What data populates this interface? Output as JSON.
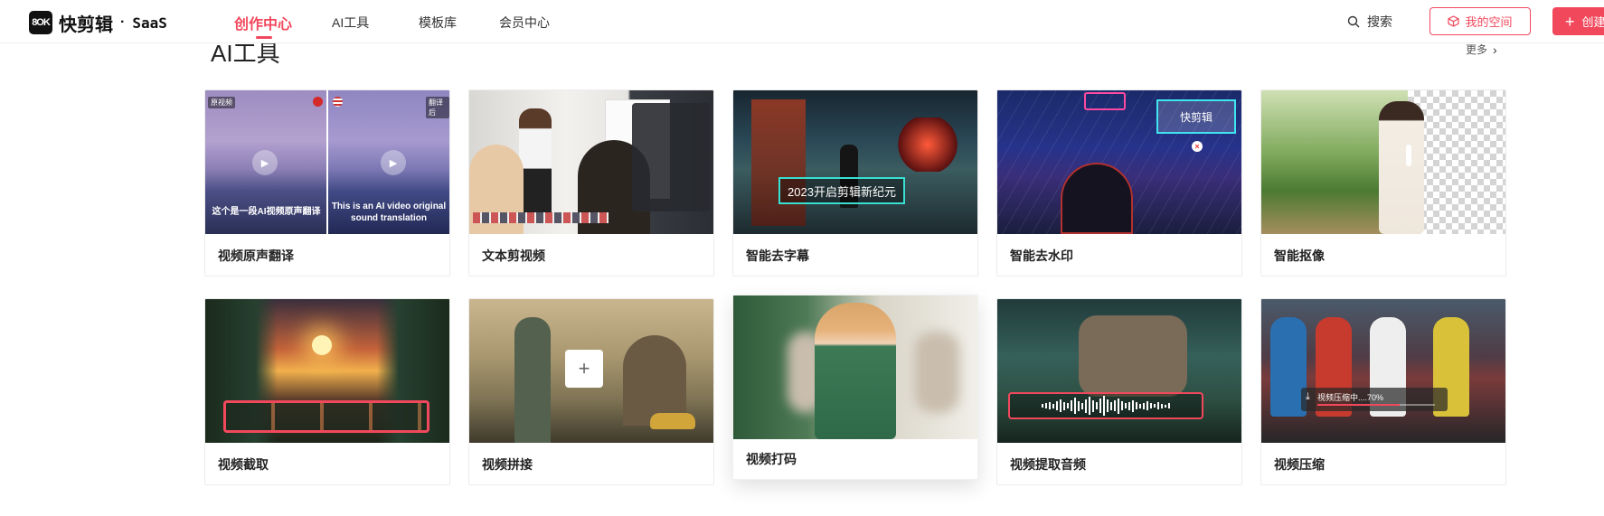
{
  "header": {
    "logo_mark": "8OK",
    "brand_name": "快剪辑",
    "brand_dot": "·",
    "brand_suffix": "SaaS",
    "nav": [
      {
        "label": "创作中心",
        "active": true
      },
      {
        "label": "AI工具",
        "active": false
      },
      {
        "label": "模板库",
        "active": false
      },
      {
        "label": "会员中心",
        "active": false
      }
    ],
    "search_label": "搜索",
    "my_space_label": "我的空间",
    "create_label": "创建"
  },
  "section": {
    "title": "AI工具",
    "more_label": "更多"
  },
  "tools": [
    {
      "label": "视频原声翻译",
      "icon": "translate-thumb"
    },
    {
      "label": "文本剪视频",
      "icon": "text-cut-thumb"
    },
    {
      "label": "智能去字幕",
      "icon": "remove-subtitle-thumb"
    },
    {
      "label": "智能去水印",
      "icon": "remove-watermark-thumb"
    },
    {
      "label": "智能抠像",
      "icon": "matting-thumb"
    },
    {
      "label": "视频截取",
      "icon": "clip-thumb"
    },
    {
      "label": "视频拼接",
      "icon": "stitch-thumb"
    },
    {
      "label": "视频打码",
      "icon": "blur-thumb"
    },
    {
      "label": "视频提取音频",
      "icon": "extract-audio-thumb"
    },
    {
      "label": "视频压缩",
      "icon": "compress-thumb"
    }
  ],
  "thumbnail_text": {
    "translate_tag_left": "原视频",
    "translate_tag_right": "翻译后",
    "translate_caption_zh": "这个是一段AI视频原声翻译",
    "translate_caption_en": "This is an AI video original sound translation",
    "subtitle_demo": "2023开启剪辑新纪元",
    "watermark_demo": "快剪辑",
    "compress_status": "视频压缩中....70%"
  },
  "compress_progress": 0.7,
  "colors": {
    "accent": "#f2485c"
  }
}
